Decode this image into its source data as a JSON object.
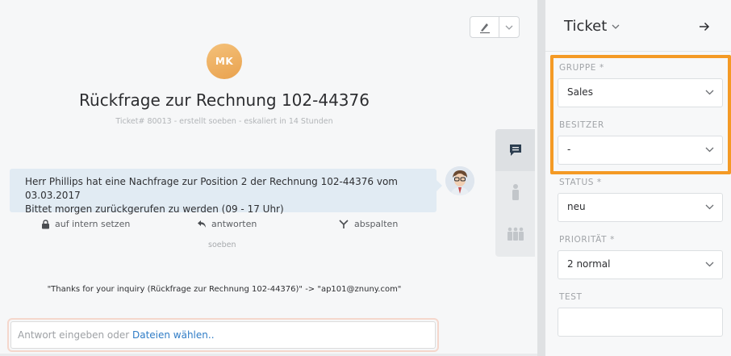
{
  "ticket": {
    "avatar_initials": "MK",
    "title": "Rückfrage zur Rechnung 102-44376",
    "meta": "Ticket# 80013 - erstellt soeben - eskaliert in 14 Stunden"
  },
  "article": {
    "line1": "Herr Phillips hat eine Nachfrage zur Position 2 der Rechnung 102-44376 vom 03.03.2017",
    "line2": "Bittet morgen zurückgerufen zu werden (09 - 17 Uhr)",
    "actions": {
      "internal": "auf intern setzen",
      "reply": "antworten",
      "split": "abspalten"
    },
    "timestamp": "soeben"
  },
  "email_line": "\"Thanks for your inquiry (Rückfrage zur Rechnung 102-44376)\" -> \"ap101@znuny.com\"",
  "reply": {
    "placeholder": "Antwort eingeben oder ",
    "link": "Dateien wählen.."
  },
  "sidebar": {
    "title": "Ticket",
    "fields": {
      "group_label": "GRUPPE *",
      "group_value": "Sales",
      "owner_label": "BESITZER",
      "owner_value": "-",
      "state_label": "STATUS *",
      "state_value": "neu",
      "priority_label": "PRIORITÄT *",
      "priority_value": "2 normal",
      "test_label": "TEST",
      "test_value": ""
    }
  },
  "colors": {
    "highlight": "#f49a25",
    "article_bg": "#e1ebf3",
    "link": "#2f7cc6",
    "avatar": "#eda957"
  }
}
